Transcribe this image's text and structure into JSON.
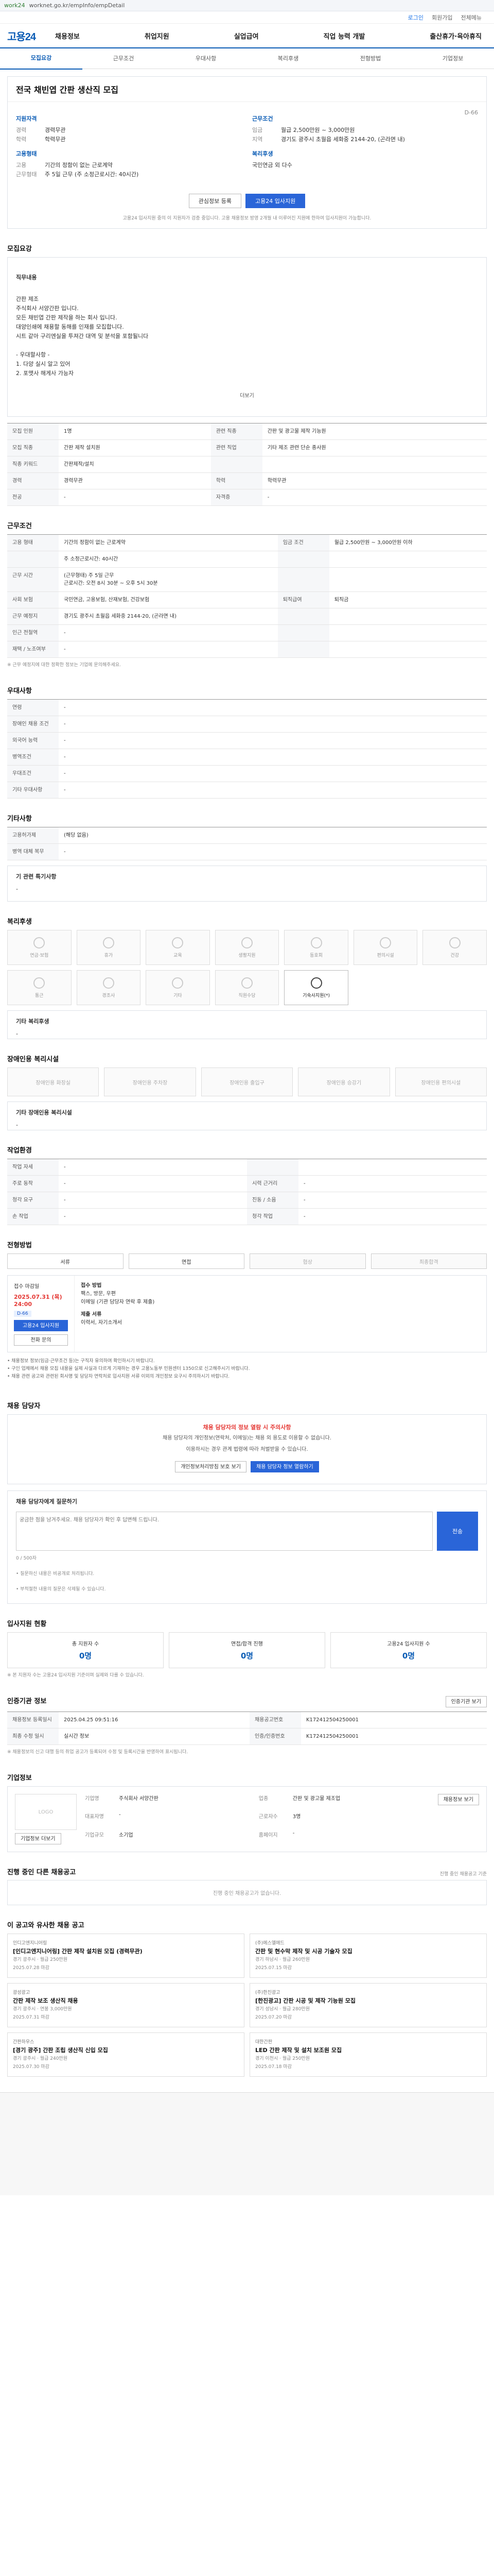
{
  "browser": {
    "url": "worknet.go.kr/empInfo/empDetail",
    "source": "work24"
  },
  "utility": {
    "login": "로그인",
    "join": "회원가입",
    "sitemap": "전체메뉴"
  },
  "gnb": {
    "logo": "고용24",
    "menu": [
      "채용정보",
      "취업지원",
      "실업급여",
      "직업 능력 개발",
      "출산휴가·육아휴직"
    ]
  },
  "tabs": [
    "모집요강",
    "근무조건",
    "우대사항",
    "복리후생",
    "전형방법",
    "기업정보"
  ],
  "job": {
    "title": "전국 채빈엽 간판 생산직 모집",
    "dday": "D-66",
    "left_head": "지원자격",
    "left": [
      [
        "경력",
        "경력무관"
      ],
      [
        "학력",
        "학력무관"
      ]
    ],
    "left_head2": "고용형태",
    "left2": [
      [
        "고용",
        "기간의 정함이 없는 근로계약"
      ],
      [
        "근무형태",
        "주 5일 근무 (주 소정근로시간: 40시간)"
      ]
    ],
    "right_head": "근무조건",
    "right": [
      [
        "임금",
        "월급 2,500만원 ~ 3,000만원"
      ],
      [
        "지역",
        "경기도 광주시 초월읍 세화중 2144-20, (곤라면 내)"
      ]
    ],
    "right_head2": "복리후생",
    "right2": "국민연금 외 다수",
    "scrap": "관심정보 등록",
    "apply": "고용24 입사지원",
    "note": "고용24 입사지원 중의 이 지원자가 검증 중입니다. 고용 채용정보 방영 2개월 내 이루어진 지원에 한하여 입사지원이 가능합니다."
  },
  "recruit": {
    "title": "모집요강",
    "head": "직무내용",
    "body": "간판 제조\n주식회사 서양간판 입니다.\n모든 채빈엽 간판 제작을 하는 회사 입니다.\n대양인쇄에 채용할 동해를 인재를 모집합니다.\n시트 같아 구리엔실을 투져간 대역 및 분석을 포함될니다\n\n- 우대할사항 -\n1. 다양 실시 알고 있어\n2. 포맷사 해게사 가능자",
    "more": "더보기",
    "rows": [
      [
        "모집 인원",
        "1명",
        "관련 직종",
        "간판 및 광고물 제작 기능원"
      ],
      [
        "모집 직종",
        "간판 제작 설치원",
        "관련 직업",
        "기타 제조 관련 단순 종사원"
      ],
      [
        "직종 키워드",
        "간판제작/설치",
        "",
        ""
      ],
      [
        "경력",
        "경력무관",
        "학력",
        "학력무관"
      ],
      [
        "전공",
        "-",
        "자격증",
        "-"
      ]
    ]
  },
  "work": {
    "title": "근무조건",
    "rows": [
      [
        "고용 형태",
        "기간의 정함이 없는 근로계약",
        "임금 조건",
        "월급 2,500만원 ~ 3,000만원 이하"
      ],
      [
        "",
        "주 소정근로시간: 40시간",
        "",
        ""
      ],
      [
        "근무 시간",
        "(근무형태) 주 5일 근무\n근로시간: 오전 8시 30분 ~ 오후 5시 30분",
        "",
        ""
      ],
      [
        "사회 보험",
        "국민연금, 고용보험, 산재보험, 건강보험",
        "퇴직급여",
        "퇴직금"
      ],
      [
        "근무 예정지",
        "경기도 광주시 초월읍 세화중 2144-20, (곤라면 내)",
        "",
        ""
      ],
      [
        "인근 전철역",
        "-",
        "",
        ""
      ],
      [
        "재택 / 노조여부",
        "-",
        "",
        ""
      ]
    ],
    "note": "※ 근무 예정지에 대한 정확한 정보는 기업에 문의해주세요."
  },
  "prefer": {
    "title": "우대사항",
    "rows": [
      [
        "연령",
        "-"
      ],
      [
        "장애인 채용 조건",
        "-"
      ],
      [
        "외국어 능력",
        "-"
      ],
      [
        "병역조건",
        "-"
      ],
      [
        "우대조건",
        "-"
      ],
      [
        "기타 우대사항",
        "-"
      ]
    ]
  },
  "etc": {
    "title": "기타사항",
    "rows": [
      [
        "고용허가제",
        "(해당 없음)"
      ],
      [
        "병역 대체 복무",
        "-"
      ]
    ],
    "sub": "기 관련 특기사항",
    "val": "-"
  },
  "welfare": {
    "title": "복리후생",
    "items": [
      "연금·보험",
      "휴가",
      "교육",
      "생활지원",
      "동호회",
      "편의시설",
      "건강",
      "통근",
      "경조사",
      "기타",
      "직원수당",
      "기숙사지원(*)"
    ],
    "active": [
      "기숙사지원(*)"
    ],
    "etc_label": "기타 복리후생",
    "etc_val": "-"
  },
  "disabled": {
    "title": "장애인용 복리시설",
    "items": [
      "장애인용 화장실",
      "장애인용 주차장",
      "장애인용 출입구",
      "장애인용 승강기",
      "장애인용 편의시설"
    ],
    "etc_label": "기타 장애인용 복리시설",
    "etc_val": "-"
  },
  "workenv": {
    "title": "작업환경",
    "rows": [
      [
        "작업 자세",
        "-",
        "",
        ""
      ],
      [
        "주로 동작",
        "-",
        "시력 근거리",
        "-"
      ],
      [
        "청각 요구",
        "-",
        "진동 / 소음",
        "-"
      ],
      [
        "손 작업",
        "-",
        "청각 작업",
        "-"
      ]
    ]
  },
  "process": {
    "title": "전형방법",
    "steps": [
      "서류",
      "면접",
      "협상",
      "최종합격"
    ],
    "apply_head": "접수 마감일",
    "apply_date": "2025.07.31 (목) 24:00",
    "dday": "D-66",
    "apply_btn": "고용24 입사지원",
    "contact_btn": "전화 문의",
    "method_head": "접수 방법",
    "method": "팩스, 방문, 우편\n이메일 (기관 담당자 연락 후 제출)",
    "docs_head": "제출 서류",
    "docs": "이력서, 자기소개서"
  },
  "bullets": "• 채용정보 정보(임금·근무조건 등)는 구직자 유의하여 확인하시기 바랍니다.\n• 구인 업체에서 채용 모집 내용을 실제 사실과 다르게 기재하는 경우 고용노동부 민원센터 1350으로 신고해주시기 바랍니다.\n• 채용 관련 공고와 관련된 회사명 및 담당자 연락처로 입사지원 서류 이외의 개인정보 요구시 주의하시기 바랍니다.",
  "contact": {
    "title": "채용 담당자",
    "warn": "채용 담당자의 정보 열람 시 주의사항",
    "p1": "채용 담당자의 개인정보(연락처, 이메일)는 채용 외 용도로 이용할 수 없습니다.",
    "p2": "이용하시는 경우 관계 법령에 따라 처벌받을 수 있습니다.",
    "btn1": "개인정보처리방침 보호 보기",
    "btn2": "채용 담당자 정보 열람하기"
  },
  "qa": {
    "title": "채용 담당자에게 질문하기",
    "placeholder": "궁금한 점을 남겨주세요. 채용 담당자가 확인 후 답변해 드립니다.",
    "limit": "0 / 500자",
    "submit": "전송",
    "n1": "• 질문하신 내용은 비공개로 처리됩니다.",
    "n2": "• 부적절한 내용의 질문은 삭제될 수 있습니다."
  },
  "stats": {
    "title": "입사지원 현황",
    "items": [
      [
        "총 지원자 수",
        "0명"
      ],
      [
        "면접/합격 진행",
        "0명"
      ],
      [
        "고용24 입사지원 수",
        "0명"
      ]
    ],
    "note": "※ 본 지원자 수는 고용24 입사지원 기준이며 실제와 다를 수 있습니다."
  },
  "agency": {
    "title": "인증기관 정보",
    "btn": "인증기관 보기",
    "rows": [
      [
        "채용정보 등록일시",
        "2025.04.25 09:51:16",
        "채용공고번호",
        "K172412504250001"
      ],
      [
        "최종 수정 일시",
        "실시간 정보",
        "인증/인증번호",
        "K172412504250001"
      ]
    ],
    "note": "※ 채용정보의 신고 대행 등의 취업 공고가 등록되어 수정 및 등록시간을 반영하여 표시됩니다."
  },
  "company": {
    "title": "기업정보",
    "logo": "LOGO",
    "btn": "채용정보 보기",
    "btn2": "기업정보 더보기",
    "rows": [
      [
        "기업명",
        "주식회사 서양간판",
        "업종",
        "간판 및 광고물 제조업"
      ],
      [
        "대표자명",
        "-",
        "근로자수",
        "3명"
      ],
      [
        "기업규모",
        "소기업",
        "홈페이지",
        "-"
      ]
    ]
  },
  "progress": {
    "title": "진행 중인 다른 채용공고",
    "note": "진행 중인 채용공고 기준",
    "empty": "진행 중인 채용공고가 없습니다."
  },
  "recommend": {
    "title": "이 공고와 유사한 채용 공고",
    "items": [
      {
        "co": "인디고엔지니어링",
        "title": "[인디고엔지니어링] 간판 제작 설치원 모집 (경력무관)",
        "meta": "경기 광주시 · 월급 250만원",
        "date": "2025.07.28 마감"
      },
      {
        "co": "(주)에스엘애드",
        "title": "간판 및 현수막 제작 및 시공 기술자 모집",
        "meta": "경기 하남시 · 월급 260만원",
        "date": "2025.07.15 마감"
      },
      {
        "co": "광성광고",
        "title": "간판 제작 보조 생산직 채용",
        "meta": "경기 광주시 · 연봉 3,000만원",
        "date": "2025.07.31 마감"
      },
      {
        "co": "(주)한진광고",
        "title": "[한진광고] 간판 시공 및 제작 기능원 모집",
        "meta": "경기 성남시 · 월급 280만원",
        "date": "2025.07.20 마감"
      },
      {
        "co": "간판하우스",
        "title": "[경기 광주] 간판 조립 생산직 신입 모집",
        "meta": "경기 광주시 · 월급 240만원",
        "date": "2025.07.30 마감"
      },
      {
        "co": "대한간판",
        "title": "LED 간판 제작 및 설치 보조원 모집",
        "meta": "경기 이천시 · 월급 250만원",
        "date": "2025.07.18 마감"
      }
    ]
  }
}
